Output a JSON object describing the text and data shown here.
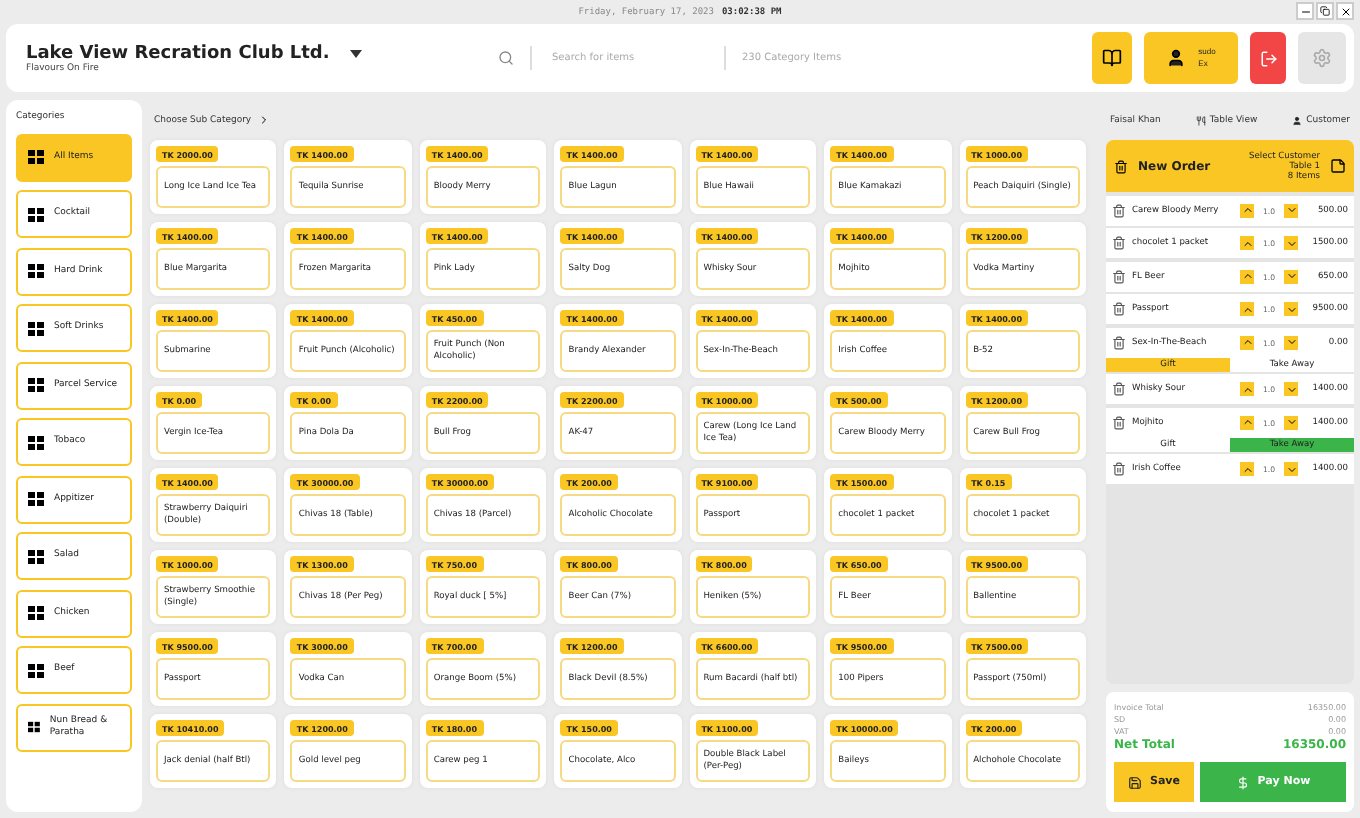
{
  "clock": {
    "date": "Friday, February 17, 2023",
    "time": "03:02:38 PM"
  },
  "header": {
    "title": "Lake View Recration Club Ltd.",
    "subtitle": "Flavours On Fire",
    "search": {
      "placeholder": "Search for items"
    },
    "category_count": "230 Category Items",
    "user": {
      "name": "sudo",
      "role": "Ex"
    }
  },
  "categories_label": "Categories",
  "categories": [
    {
      "label": "All Items",
      "selected": true
    },
    {
      "label": "Cocktail",
      "selected": false
    },
    {
      "label": "Hard Drink",
      "selected": false
    },
    {
      "label": "Soft Drinks",
      "selected": false
    },
    {
      "label": "Parcel Service",
      "selected": false
    },
    {
      "label": "Tobaco",
      "selected": false
    },
    {
      "label": "Appitizer",
      "selected": false
    },
    {
      "label": "Salad",
      "selected": false
    },
    {
      "label": "Chicken",
      "selected": false
    },
    {
      "label": "Beef",
      "selected": false
    },
    {
      "label": "Nun Bread & Paratha",
      "selected": false
    }
  ],
  "subcategory_label": "Choose Sub Category",
  "items": [
    {
      "price": "TK 2000.00",
      "name": "Long Ice Land Ice Tea"
    },
    {
      "price": "TK 1400.00",
      "name": "Tequila Sunrise"
    },
    {
      "price": "TK 1400.00",
      "name": "Bloody Merry"
    },
    {
      "price": "TK 1400.00",
      "name": "Blue Lagun"
    },
    {
      "price": "TK 1400.00",
      "name": "Blue Hawaii"
    },
    {
      "price": "TK 1400.00",
      "name": "Blue Kamakazi"
    },
    {
      "price": "TK 1000.00",
      "name": "Peach Daiquiri (Single)"
    },
    {
      "price": "TK 1400.00",
      "name": "Blue Margarita"
    },
    {
      "price": "TK 1400.00",
      "name": "Frozen Margarita"
    },
    {
      "price": "TK 1400.00",
      "name": "Pink Lady"
    },
    {
      "price": "TK 1400.00",
      "name": "Salty Dog"
    },
    {
      "price": "TK 1400.00",
      "name": "Whisky Sour"
    },
    {
      "price": "TK 1400.00",
      "name": "Mojhito"
    },
    {
      "price": "TK 1200.00",
      "name": "Vodka Martiny"
    },
    {
      "price": "TK 1400.00",
      "name": "Submarine"
    },
    {
      "price": "TK 1400.00",
      "name": "Fruit Punch (Alcoholic)"
    },
    {
      "price": "TK 450.00",
      "name": "Fruit Punch (Non Alcoholic)"
    },
    {
      "price": "TK 1400.00",
      "name": "Brandy Alexander"
    },
    {
      "price": "TK 1400.00",
      "name": "Sex-In-The-Beach"
    },
    {
      "price": "TK 1400.00",
      "name": "Irish Coffee"
    },
    {
      "price": "TK 1400.00",
      "name": "B-52"
    },
    {
      "price": "TK 0.00",
      "name": "Vergin Ice-Tea"
    },
    {
      "price": "TK 0.00",
      "name": "Pina Dola Da"
    },
    {
      "price": "TK 2200.00",
      "name": "Bull Frog"
    },
    {
      "price": "TK 2200.00",
      "name": "AK-47"
    },
    {
      "price": "TK 1000.00",
      "name": "Carew (Long Ice Land Ice Tea)"
    },
    {
      "price": "TK 500.00",
      "name": "Carew Bloody Merry"
    },
    {
      "price": "TK 1200.00",
      "name": "Carew Bull Frog"
    },
    {
      "price": "TK 1400.00",
      "name": "Strawberry Daiquiri (Double)"
    },
    {
      "price": "TK 30000.00",
      "name": "Chivas 18 (Table)"
    },
    {
      "price": "TK 30000.00",
      "name": "Chivas 18 (Parcel)"
    },
    {
      "price": "TK 200.00",
      "name": "Alcoholic Chocolate"
    },
    {
      "price": "TK 9100.00",
      "name": "Passport"
    },
    {
      "price": "TK 1500.00",
      "name": "chocolet 1 packet"
    },
    {
      "price": "TK 0.15",
      "name": "chocolet 1 packet"
    },
    {
      "price": "TK 1000.00",
      "name": "Strawberry Smoothie (Single)"
    },
    {
      "price": "TK 1300.00",
      "name": "Chivas 18 (Per Peg)"
    },
    {
      "price": "TK 750.00",
      "name": "Royal duck [ 5%]"
    },
    {
      "price": "TK 800.00",
      "name": "Beer Can (7%)"
    },
    {
      "price": "TK 800.00",
      "name": "Heniken (5%)"
    },
    {
      "price": "TK 650.00",
      "name": "FL Beer"
    },
    {
      "price": "TK 9500.00",
      "name": "Ballentine"
    },
    {
      "price": "TK 9500.00",
      "name": "Passport"
    },
    {
      "price": "TK 3000.00",
      "name": "Vodka Can"
    },
    {
      "price": "TK 700.00",
      "name": "Orange Boom (5%)"
    },
    {
      "price": "TK 1200.00",
      "name": "Black Devil (8.5%)"
    },
    {
      "price": "TK 6600.00",
      "name": "Rum Bacardi (half btl)"
    },
    {
      "price": "TK 9500.00",
      "name": "100 Pipers"
    },
    {
      "price": "TK 7500.00",
      "name": "Passport (750ml)"
    },
    {
      "price": "TK 10410.00",
      "name": "Jack denial (half Btl)"
    },
    {
      "price": "TK 1200.00",
      "name": "Gold level peg"
    },
    {
      "price": "TK 180.00",
      "name": "Carew peg 1"
    },
    {
      "price": "TK 150.00",
      "name": "Chocolate, Alco"
    },
    {
      "price": "TK 1100.00",
      "name": "Double Black Label (Per-Peg)"
    },
    {
      "price": "TK 10000.00",
      "name": "Baileys"
    },
    {
      "price": "TK 200.00",
      "name": "Alchohole Chocolate"
    }
  ],
  "order": {
    "waiter": "Faisal Khan",
    "table_view": "Table View",
    "customer": "Customer",
    "title": "New Order",
    "select_customer": "Select Customer",
    "table": "Table 1",
    "count": "8 Items",
    "lines": [
      {
        "name": "Carew Bloody Merry",
        "qty": "1.0",
        "price": "500.00"
      },
      {
        "name": "chocolet 1 packet",
        "qty": "1.0",
        "price": "1500.00"
      },
      {
        "name": "FL Beer",
        "qty": "1.0",
        "price": "650.00"
      },
      {
        "name": "Passport",
        "qty": "1.0",
        "price": "9500.00"
      },
      {
        "name": "Sex-In-The-Beach",
        "qty": "1.0",
        "price": "0.00",
        "options": [
          {
            "kind": "gift",
            "label": "Gift",
            "selected": true
          },
          {
            "kind": "takeaway",
            "label": "Take Away",
            "selected": false
          }
        ]
      },
      {
        "name": "Whisky Sour",
        "qty": "1.0",
        "price": "1400.00"
      },
      {
        "name": "Mojhito",
        "qty": "1.0",
        "price": "1400.00",
        "options": [
          {
            "kind": "gift",
            "label": "Gift",
            "selected": false
          },
          {
            "kind": "takeaway",
            "label": "Take Away",
            "selected": true
          }
        ]
      },
      {
        "name": "Irish Coffee",
        "qty": "1.0",
        "price": "1400.00"
      }
    ],
    "totals": [
      {
        "label": "Invoice Total",
        "value": "16350.00"
      },
      {
        "label": "SD",
        "value": "0.00"
      },
      {
        "label": "VAT",
        "value": "0.00"
      }
    ],
    "net_total": {
      "label": "Net Total",
      "value": "16350.00"
    },
    "buttons": {
      "save": "Save",
      "pay": "Pay Now"
    }
  }
}
